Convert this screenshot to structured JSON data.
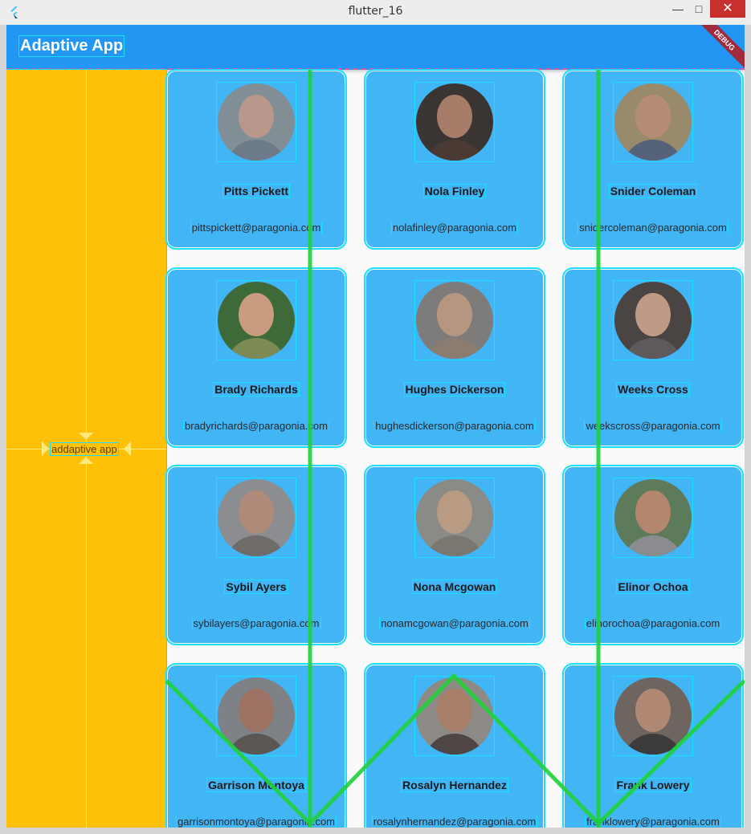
{
  "window": {
    "title": "flutter_16",
    "close_glyph": "✕",
    "min_glyph": "—",
    "max_glyph": "□"
  },
  "appbar": {
    "title": "Adaptive App",
    "debug_label": "DEBUG",
    "color": "#2196f3"
  },
  "sidebar": {
    "label": "addaptive app",
    "color": "#fec107"
  },
  "contacts": [
    {
      "name": "Pitts Pickett",
      "email": "pittspickett@paragonia.com"
    },
    {
      "name": "Nola Finley",
      "email": "nolafinley@paragonia.com"
    },
    {
      "name": "Snider Coleman",
      "email": "snidercoleman@paragonia.com"
    },
    {
      "name": "Brady Richards",
      "email": "bradyrichards@paragonia.com"
    },
    {
      "name": "Hughes Dickerson",
      "email": "hughesdickerson@paragonia.com"
    },
    {
      "name": "Weeks Cross",
      "email": "weekscross@paragonia.com"
    },
    {
      "name": "Sybil Ayers",
      "email": "sybilayers@paragonia.com"
    },
    {
      "name": "Nona Mcgowan",
      "email": "nonamcgowan@paragonia.com"
    },
    {
      "name": "Elinor Ochoa",
      "email": "elinorochoa@paragonia.com"
    },
    {
      "name": "Garrison Montoya",
      "email": "garrisonmontoya@paragonia.com"
    },
    {
      "name": "Rosalyn Hernandez",
      "email": "rosalynhernandez@paragonia.com"
    },
    {
      "name": "Frank Lowery",
      "email": "franklowery@paragonia.com"
    }
  ],
  "colors": {
    "card": "#42b5f5",
    "debug_outline": "#19e0ff",
    "overlay_line": "#1fd13a"
  }
}
